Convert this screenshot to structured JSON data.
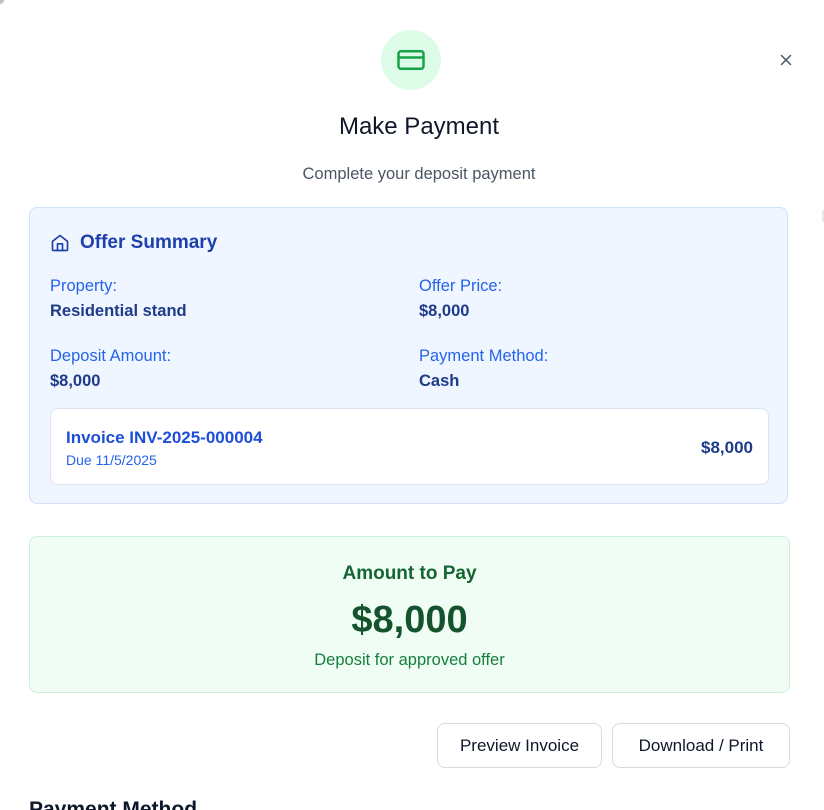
{
  "dialog": {
    "title": "Make Payment",
    "subtitle": "Complete your deposit payment",
    "header_icon": "credit-card-icon",
    "close_icon": "close-icon"
  },
  "offer_summary": {
    "title": "Offer Summary",
    "icon": "home-icon",
    "fields": [
      {
        "label": "Property:",
        "value": "Residential stand"
      },
      {
        "label": "Offer Price:",
        "value": "$8,000"
      },
      {
        "label": "Deposit Amount:",
        "value": "$8,000"
      },
      {
        "label": "Payment Method:",
        "value": "Cash"
      }
    ],
    "invoice": {
      "number": "Invoice INV-2025-000004",
      "due": "Due 11/5/2025",
      "amount": "$8,000"
    }
  },
  "amount_to_pay": {
    "label": "Amount to Pay",
    "value": "$8,000",
    "note": "Deposit for approved offer"
  },
  "actions": {
    "preview_label": "Preview Invoice",
    "download_label": "Download / Print"
  },
  "next_section": {
    "heading": "Payment Method"
  },
  "colors": {
    "green_accent": "#16a34a",
    "blue_accent": "#1e40af",
    "summary_bg": "#eff6ff",
    "amount_bg": "#f0fdf4"
  }
}
